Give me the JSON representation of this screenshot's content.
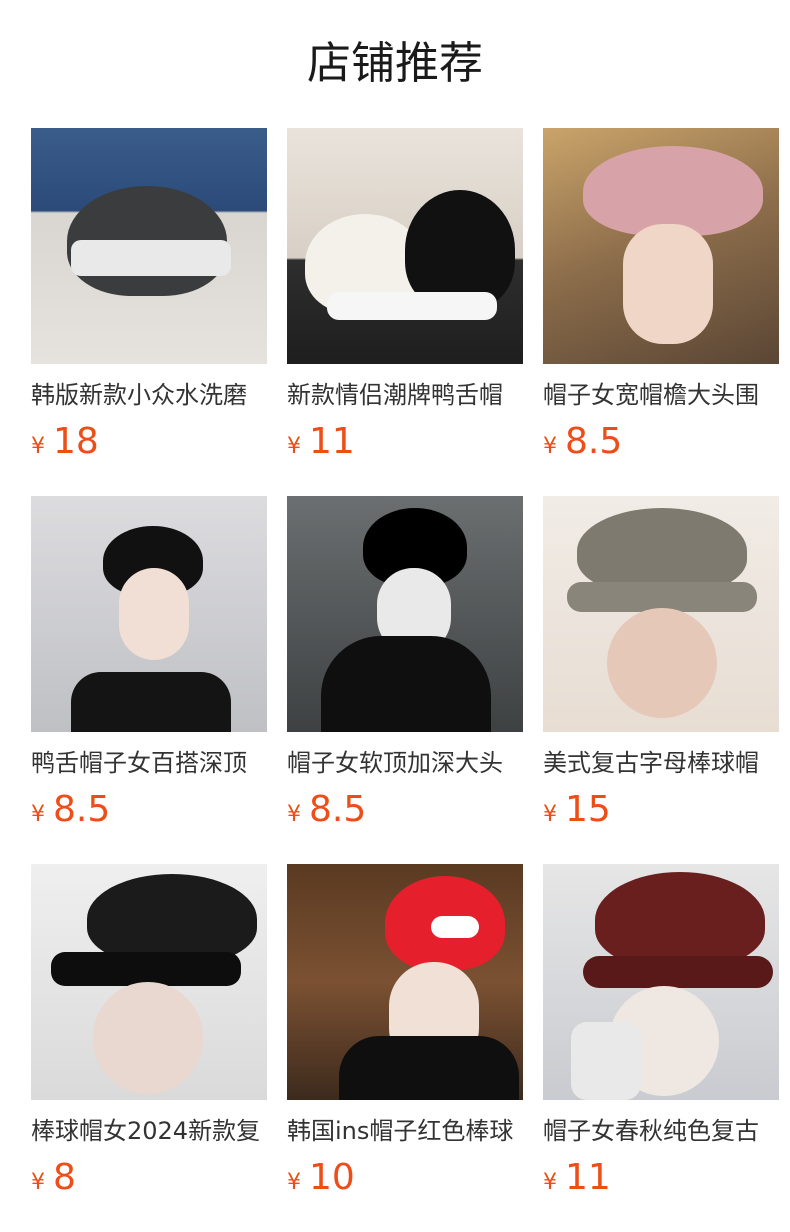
{
  "page": {
    "title": "店铺推荐"
  },
  "products": [
    {
      "name": "韩版新款小众水洗磨",
      "currency": "¥",
      "price": "18",
      "image_icon": "product-photo"
    },
    {
      "name": "新款情侣潮牌鸭舌帽",
      "currency": "¥",
      "price": "11",
      "image_icon": "product-photo"
    },
    {
      "name": "帽子女宽帽檐大头围",
      "currency": "¥",
      "price": "8.5",
      "image_icon": "product-photo"
    },
    {
      "name": "鸭舌帽子女百搭深顶",
      "currency": "¥",
      "price": "8.5",
      "image_icon": "product-photo"
    },
    {
      "name": "帽子女软顶加深大头",
      "currency": "¥",
      "price": "8.5",
      "image_icon": "product-photo"
    },
    {
      "name": "美式复古字母棒球帽",
      "currency": "¥",
      "price": "15",
      "image_icon": "product-photo"
    },
    {
      "name": "棒球帽女2024新款复",
      "currency": "¥",
      "price": "8",
      "image_icon": "product-photo"
    },
    {
      "name": "韩国ins帽子红色棒球",
      "currency": "¥",
      "price": "10",
      "image_icon": "product-photo"
    },
    {
      "name": "帽子女春秋纯色复古",
      "currency": "¥",
      "price": "11",
      "image_icon": "product-photo"
    }
  ],
  "colors": {
    "price": "#ee4d17",
    "text": "#333333"
  }
}
